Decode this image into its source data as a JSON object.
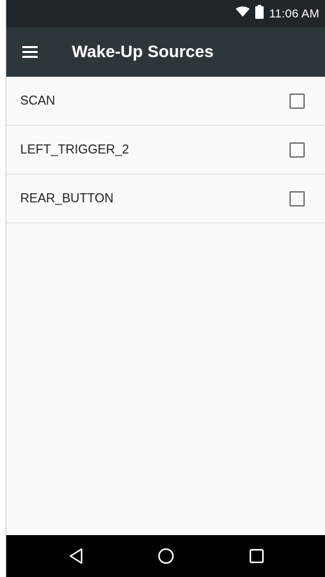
{
  "status_bar": {
    "time": "11:06 AM",
    "icons": [
      "wifi-icon",
      "battery-icon"
    ]
  },
  "app_bar": {
    "menu_icon": "hamburger-menu-icon",
    "title": "Wake-Up Sources"
  },
  "list": {
    "items": [
      {
        "label": "SCAN",
        "checked": false
      },
      {
        "label": "LEFT_TRIGGER_2",
        "checked": false
      },
      {
        "label": "REAR_BUTTON",
        "checked": false
      }
    ]
  },
  "nav_bar": {
    "buttons": [
      "back-icon",
      "home-icon",
      "recents-icon"
    ]
  },
  "colors": {
    "status_bar_bg": "#1f2528",
    "app_bar_bg": "#2d363b",
    "content_bg": "#fafafa",
    "nav_bar_bg": "#000000"
  }
}
